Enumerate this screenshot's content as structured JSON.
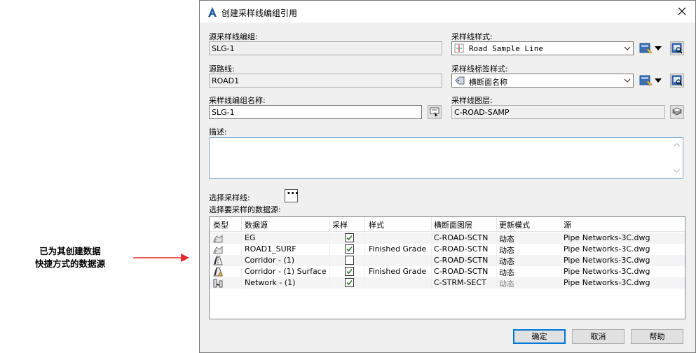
{
  "callout": {
    "line1": "已为其创建数据",
    "line2": "快捷方式的数据源",
    "arrow_color": "#e8262b"
  },
  "dialog": {
    "title": "创建采样线编组引用",
    "app_icon": "autocad-a-icon",
    "close_icon": "close-icon"
  },
  "source_group": {
    "label": "源采样线编组:",
    "value": "SLG-1"
  },
  "source_alignment": {
    "label": "源路线:",
    "value": "ROAD1"
  },
  "group_name": {
    "label": "采样线编组名称:",
    "value": "SLG-1",
    "button_icon": "pick-name-icon"
  },
  "sample_line_style": {
    "label": "采样线样式:",
    "value": "Road Sample Line",
    "icon": "sample-line-style-icon"
  },
  "label_style": {
    "label": "采样线标签样式:",
    "value": "横断面名称",
    "icon": "label-style-icon"
  },
  "layer": {
    "label": "采样线图层:",
    "value": "C-ROAD-SAMP",
    "button_icon": "layer-icon"
  },
  "description": {
    "label": "描述:",
    "value": ""
  },
  "select_sample_lines": {
    "label": "选择采样线:",
    "button_text": "•••"
  },
  "data_sources_label": "选择要采样的数据源:",
  "table": {
    "columns": [
      "类型",
      "数据源",
      "采样",
      "样式",
      "横断面图层",
      "更新模式",
      "源"
    ],
    "rows": [
      {
        "type_icon": "surface-reference-icon",
        "source": "EG",
        "sampled": true,
        "style": "",
        "layer": "C-ROAD-SCTN",
        "update_mode": "动态",
        "update_dim": false,
        "origin": "Pipe Networks-3C.dwg"
      },
      {
        "type_icon": "surface-reference-icon",
        "source": "ROAD1_SURF",
        "sampled": true,
        "style": "Finished Grade",
        "layer": "C-ROAD-SCTN",
        "update_mode": "动态",
        "update_dim": false,
        "origin": "Pipe Networks-3C.dwg"
      },
      {
        "type_icon": "corridor-icon",
        "source": "Corridor - (1)",
        "sampled": false,
        "style": "",
        "layer": "C-ROAD-SCTN",
        "update_mode": "动态",
        "update_dim": false,
        "origin": "Pipe Networks-3C.dwg"
      },
      {
        "type_icon": "corridor-surface-icon",
        "source": "Corridor - (1) Surface",
        "sampled": true,
        "style": "Finished Grade",
        "layer": "C-ROAD-SCTN",
        "update_mode": "动态",
        "update_dim": false,
        "origin": "Pipe Networks-3C.dwg"
      },
      {
        "type_icon": "pipe-network-icon",
        "source": "Network - (1)",
        "sampled": true,
        "style": "",
        "layer": "C-STRM-SECT",
        "update_mode": "动态",
        "update_dim": true,
        "origin": "Pipe Networks-3C.dwg"
      }
    ]
  },
  "buttons": {
    "ok": "确定",
    "cancel": "取消",
    "help": "帮助"
  }
}
